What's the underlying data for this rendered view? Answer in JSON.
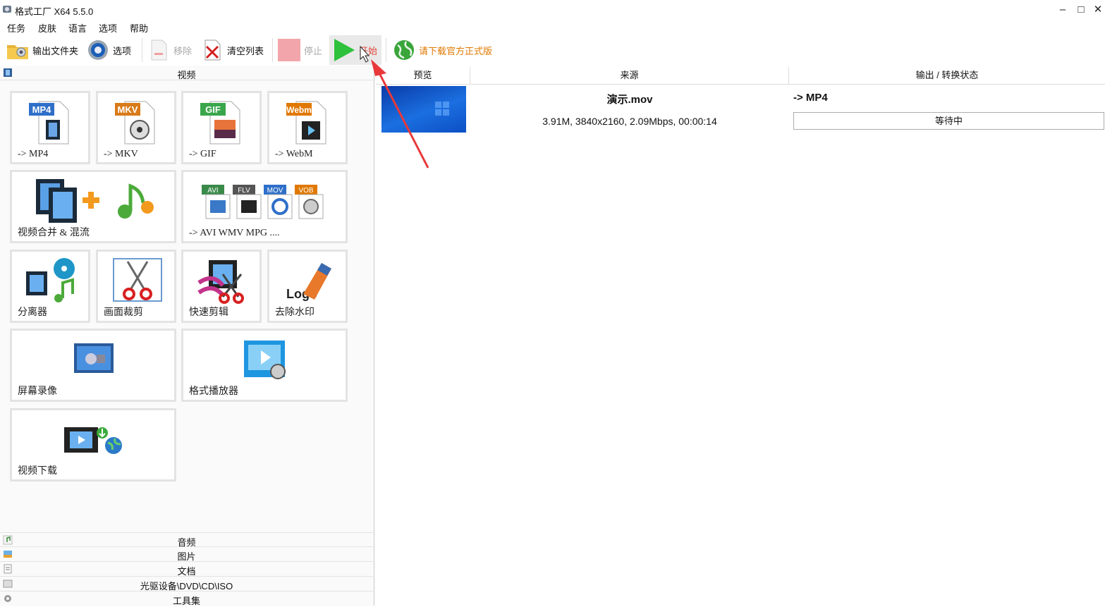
{
  "window": {
    "title": "格式工厂 X64 5.5.0",
    "minimize": "–",
    "maximize": "□",
    "close": "✕"
  },
  "menu": [
    "任务",
    "皮肤",
    "语言",
    "选项",
    "帮助"
  ],
  "toolbar": {
    "output_folder": "输出文件夹",
    "options": "选项",
    "remove": "移除",
    "clear_list": "清空列表",
    "stop": "停止",
    "start": "开始",
    "download_notice": "请下载官方正式版"
  },
  "video_section": {
    "header": "视频",
    "tiles": [
      {
        "label": "-> MP4",
        "badge": "MP4",
        "badge_color": "#2f6fc9"
      },
      {
        "label": "-> MKV",
        "badge": "MKV",
        "badge_color": "#d97a18"
      },
      {
        "label": "-> GIF",
        "badge": "GIF",
        "badge_color": "#3aa64b"
      },
      {
        "label": "-> WebM",
        "badge": "Webm",
        "badge_color": "#e07800"
      },
      {
        "label": "视频合并 & 混流"
      },
      {
        "label": "-> AVI WMV MPG ....",
        "badges": [
          "AVI",
          "FLV",
          "MOV",
          "VOB"
        ]
      },
      {
        "label": "分离器"
      },
      {
        "label": "画面裁剪"
      },
      {
        "label": "快速剪辑"
      },
      {
        "label": "去除水印",
        "logo_text": "Logo"
      },
      {
        "label": "屏幕录像"
      },
      {
        "label": "格式播放器"
      },
      {
        "label": "视频下载"
      }
    ]
  },
  "categories": [
    "音频",
    "图片",
    "文档",
    "光驱设备\\DVD\\CD\\ISO",
    "工具集"
  ],
  "task_list": {
    "columns": [
      "预览",
      "来源",
      "输出 / 转换状态"
    ],
    "rows": [
      {
        "name": "演示.mov",
        "info": "3.91M, 3840x2160, 2.09Mbps, 00:00:14",
        "target": "-> MP4",
        "status": "等待中"
      }
    ]
  }
}
